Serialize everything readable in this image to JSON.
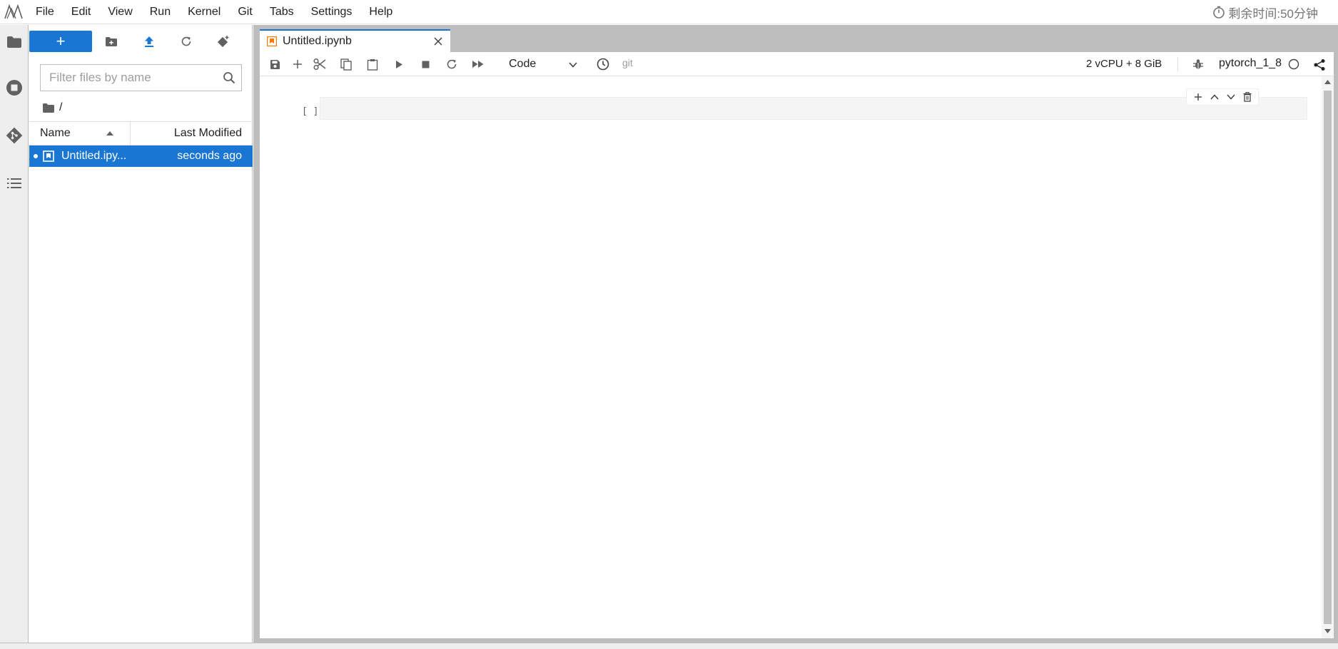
{
  "menubar": {
    "items": [
      "File",
      "Edit",
      "View",
      "Run",
      "Kernel",
      "Git",
      "Tabs",
      "Settings",
      "Help"
    ],
    "timer_text": "剩余时间:50分钟"
  },
  "activitybar": {
    "icons": [
      "folder-icon",
      "running-icon",
      "git-icon",
      "toc-icon"
    ]
  },
  "filebrowser": {
    "new_label": "+",
    "filter_placeholder": "Filter files by name",
    "breadcrumb": "/",
    "columns": {
      "name": "Name",
      "modified": "Last Modified"
    },
    "files": [
      {
        "name": "Untitled.ipy...",
        "modified": "seconds ago",
        "selected": true
      }
    ]
  },
  "tabs": [
    {
      "label": "Untitled.ipynb",
      "active": true
    }
  ],
  "notebook_toolbar": {
    "cell_type": "Code",
    "git_label": "git",
    "resources": "2 vCPU + 8 GiB",
    "kernel_name": "pytorch_1_8"
  },
  "cell": {
    "prompt": "[ ]"
  },
  "colors": {
    "accent": "#1976d2",
    "tab_icon": "#f57c00",
    "panel_bg": "#bdbdbd"
  }
}
